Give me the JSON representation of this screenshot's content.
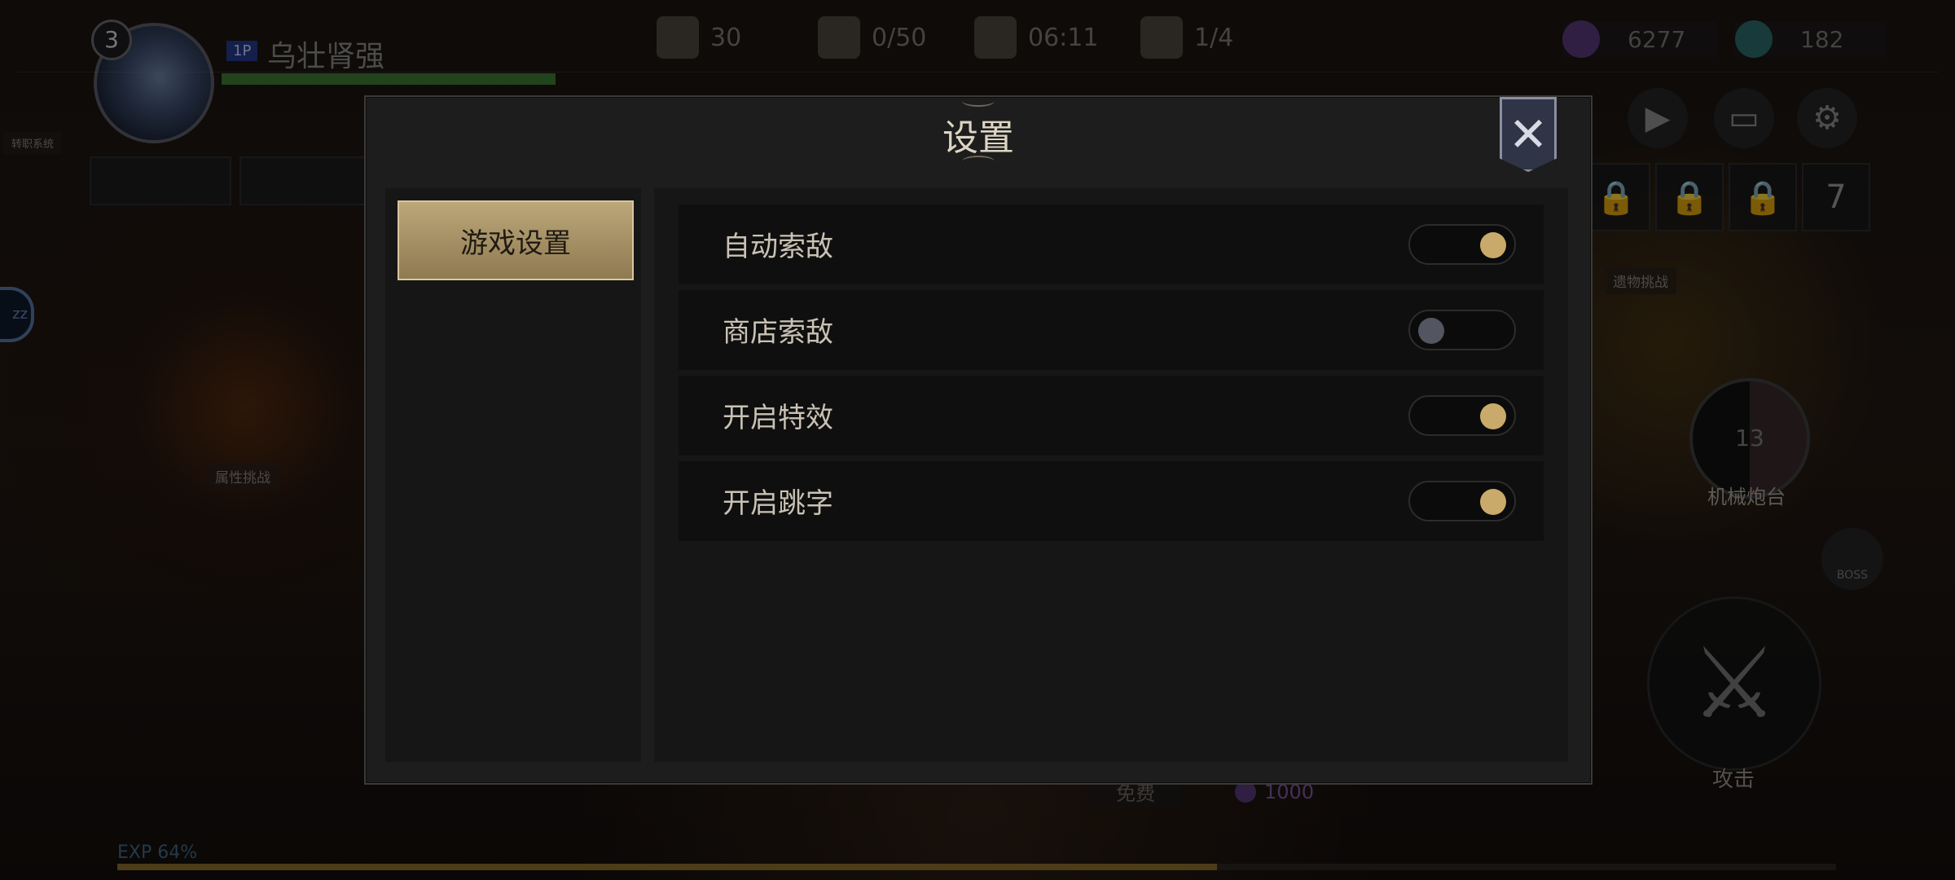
{
  "hud": {
    "level": "3",
    "player_tag": "1P",
    "player_name": "乌壮肾强",
    "stats": {
      "power": "30",
      "hearts": "0/50",
      "timer": "06:11",
      "wave": "1/4"
    },
    "resources": {
      "purple_gems": "6277",
      "crystals": "182"
    },
    "labels": {
      "left_tag": "转职系统",
      "attr_challenge": "属性挑战",
      "item_challenge": "遗物挑战",
      "mech_turret": "机械炮台",
      "boss": "BOSS",
      "attack": "攻击",
      "free": "免费",
      "cost": "1000",
      "mech_value": "13"
    },
    "exp_label": "EXP 64%",
    "exp_percent": 64,
    "slot_seven": "7"
  },
  "modal": {
    "title": "设置",
    "close_icon": "close-icon",
    "tabs": [
      {
        "label": "游戏设置",
        "active": true
      }
    ],
    "settings": [
      {
        "label": "自动索敌",
        "on": true
      },
      {
        "label": "商店索敌",
        "on": false
      },
      {
        "label": "开启特效",
        "on": true
      },
      {
        "label": "开启跳字",
        "on": true
      }
    ]
  },
  "colors": {
    "accent_gold": "#c9aa6a",
    "toggle_off": "#535561",
    "tab_gold": "#bca779"
  }
}
